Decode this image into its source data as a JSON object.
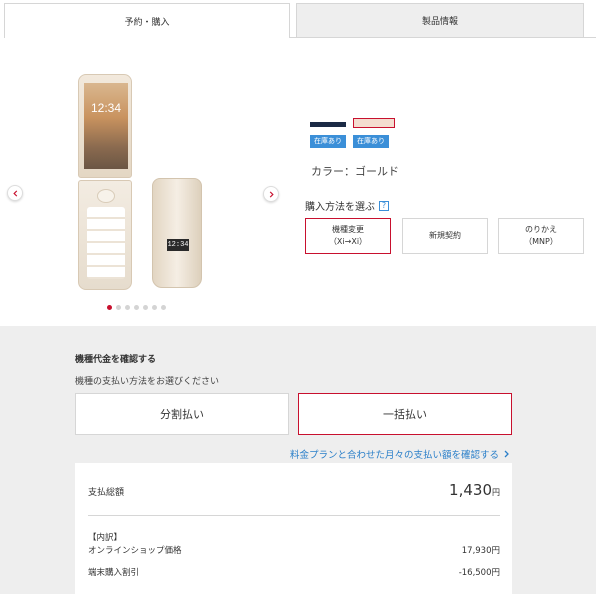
{
  "tabs": {
    "reserve": "予約・購入",
    "info": "製品情報"
  },
  "colors": {
    "accent": "#c8102e",
    "stock_badge": "#3b8fd8",
    "link": "#2a7fc9",
    "swatch_navy": "#1b2a45",
    "swatch_gold": "#f4ddd0"
  },
  "phone": {
    "open_time": "12:34",
    "closed_time": "12:34"
  },
  "stock": {
    "badge1": "在庫あり",
    "badge2": "在庫あり"
  },
  "color_label": "カラー：ゴールド",
  "buy_method": {
    "label": "購入方法を選ぶ",
    "help": "?"
  },
  "methods": [
    {
      "line1": "機種変更",
      "line2": "（Xi→Xi）"
    },
    {
      "line1": "新規契約",
      "line2": ""
    },
    {
      "line1": "のりかえ",
      "line2": "（MNP）"
    }
  ],
  "payment": {
    "title": "機種代金を確認する",
    "subtitle": "機種の支払い方法をお選びください",
    "installment": "分割払い",
    "lump_sum": "一括払い",
    "plan_link": "料金プランと合わせた月々の支払い額を確認する"
  },
  "summary": {
    "total_label": "支払総額",
    "total_value": "1,430",
    "total_unit": "円",
    "breakdown_label": "【内訳】",
    "rows": [
      {
        "label": "オンラインショップ価格",
        "value": "17,930円"
      },
      {
        "label": "端末購入割引",
        "value": "-16,500円"
      }
    ]
  },
  "carousel": {
    "slides": 7,
    "active_index": 0
  },
  "icons": {
    "prev": "chevron-left-icon",
    "next": "chevron-right-icon",
    "link": "chevron-right-icon"
  }
}
